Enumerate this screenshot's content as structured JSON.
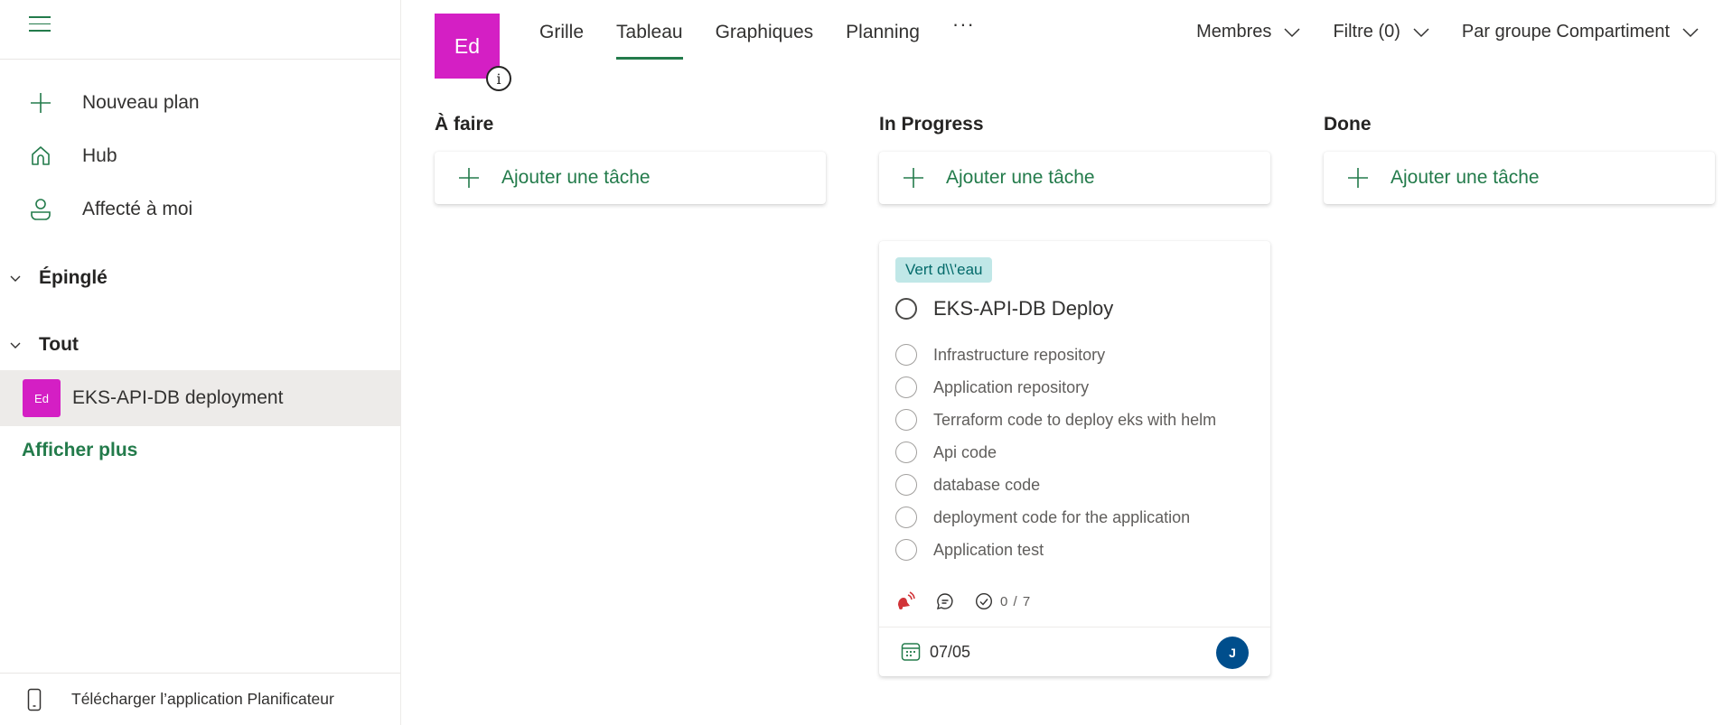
{
  "sidebar": {
    "menu_icon": "hamburger-icon",
    "nav": [
      {
        "label": "Nouveau plan",
        "icon": "plus-icon"
      },
      {
        "label": "Hub",
        "icon": "home-icon"
      },
      {
        "label": "Affecté à moi",
        "icon": "person-icon"
      }
    ],
    "sections": [
      {
        "label": "Épinglé",
        "expanded": true
      },
      {
        "label": "Tout",
        "expanded": true
      }
    ],
    "plans": [
      {
        "initials": "Ed",
        "name": "EKS-API-DB deployment",
        "color": "#d41fc4",
        "selected": true
      }
    ],
    "show_more": "Afficher plus",
    "download_app": "Télécharger l’application Planificateur"
  },
  "header": {
    "plan_initials": "Ed",
    "plan_color": "#d41fc4",
    "info_icon": "i",
    "tabs": [
      {
        "label": "Grille",
        "active": false
      },
      {
        "label": "Tableau",
        "active": true
      },
      {
        "label": "Graphiques",
        "active": false
      },
      {
        "label": "Planning",
        "active": false
      }
    ],
    "more": "···",
    "dropdowns": [
      {
        "label": "Membres"
      },
      {
        "label": "Filtre (0)"
      },
      {
        "label": "Par groupe Compartiment"
      }
    ]
  },
  "board": {
    "columns": [
      {
        "title": "À faire",
        "add_task": "Ajouter une tâche"
      },
      {
        "title": "In Progress",
        "add_task": "Ajouter une tâche"
      },
      {
        "title": "Done",
        "add_task": "Ajouter une tâche"
      }
    ],
    "cards": [
      {
        "column": "In Progress",
        "label": "Vert d\\\\'eau",
        "label_color": "#c0e7e7",
        "title": "EKS-API-DB Deploy",
        "checklist": [
          "Infrastructure repository",
          "Application repository",
          "Terraform code to deploy eks with helm",
          "Api code",
          "database code",
          "deployment code for the application",
          "Application test"
        ],
        "priority": "urgent",
        "priority_color": "#d13438",
        "checklist_progress": "0 / 7",
        "due_date": "07/05",
        "assignee_initials": "J",
        "assignee_color": "#004e8c"
      }
    ]
  },
  "colors": {
    "accent": "#237b4b",
    "selected_bg": "#edebe9"
  }
}
